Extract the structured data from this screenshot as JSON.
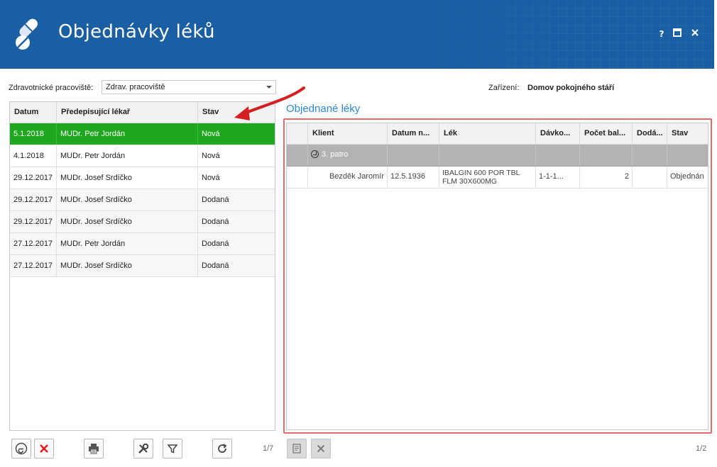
{
  "app": {
    "title": "Objednávky léků",
    "window_buttons": {
      "help": "?",
      "maximize": "▣",
      "close": "✕"
    }
  },
  "filters": {
    "workplace_label": "Zdravotnické pracoviště:",
    "workplace_value": "Zdrav. pracoviště",
    "facility_label": "Zařízení:",
    "facility_value": "Domov pokojného stáří"
  },
  "left_grid": {
    "headers": [
      "Datum",
      "Předepisující lékař",
      "Stav"
    ],
    "rows": [
      {
        "date": "5.1.2018",
        "doctor": "MUDr. Petr Jordán",
        "status": "Nová"
      },
      {
        "date": "4.1.2018",
        "doctor": "MUDr. Petr Jordán",
        "status": "Nová"
      },
      {
        "date": "29.12.2017",
        "doctor": "MUDr. Josef Srdíčko",
        "status": "Nová"
      },
      {
        "date": "29.12.2017",
        "doctor": "MUDr. Josef Srdíčko",
        "status": "Dodaná"
      },
      {
        "date": "29.12.2017",
        "doctor": "MUDr. Josef Srdíčko",
        "status": "Dodaná"
      },
      {
        "date": "27.12.2017",
        "doctor": "MUDr. Petr Jordán",
        "status": "Dodaná"
      },
      {
        "date": "27.12.2017",
        "doctor": "MUDr. Josef Srdíčko",
        "status": "Dodaná"
      }
    ],
    "pager": "1/7"
  },
  "right_panel": {
    "title": "Objednané léky",
    "headers": [
      "Klient",
      "Datum n...",
      "Lék",
      "Dávko...",
      "Počet bal...",
      "Dodá...",
      "Stav"
    ],
    "group": "3. patro",
    "rows": [
      {
        "client": "Bezděk Jaromír",
        "birth": "12.5.1936",
        "drug": "IBALGIN 600 POR TBL FLM 30X600MG",
        "dose": "1-1-1...",
        "count": "2",
        "delivered": "",
        "status": "Objednán"
      }
    ],
    "pager": "1/2"
  },
  "colors": {
    "header_bg": "#1a5fa3",
    "selected_row": "#1fa81f",
    "accent_title": "#2b8ad8",
    "highlight_frame": "#e56a6a",
    "delete_icon": "#e02020"
  }
}
